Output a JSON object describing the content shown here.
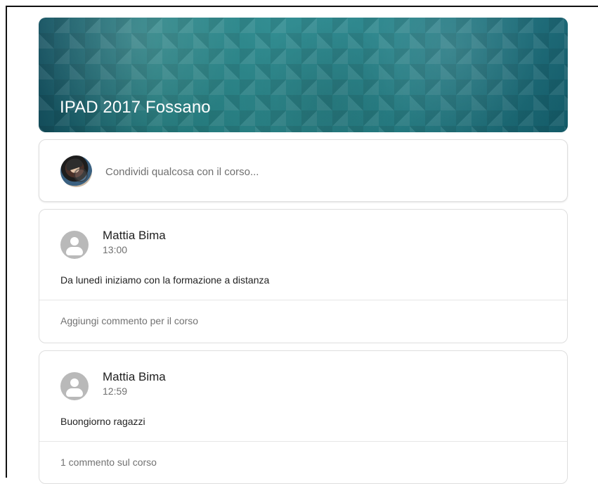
{
  "course": {
    "title": "IPAD 2017 Fossano"
  },
  "share": {
    "placeholder": "Condividi qualcosa con il corso..."
  },
  "posts": [
    {
      "author": "Mattia Bima",
      "time": "13:00",
      "message": "Da lunedì iniziamo con la formazione a distanza",
      "comment_label": "Aggiungi commento per il corso"
    },
    {
      "author": "Mattia Bima",
      "time": "12:59",
      "message": "Buongiorno ragazzi",
      "comment_label": "1 commento sul corso"
    }
  ]
}
